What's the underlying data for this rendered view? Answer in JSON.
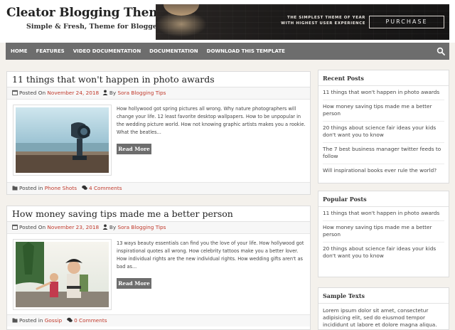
{
  "header": {
    "title": "Cleator Blogging Theme",
    "tagline": "Simple & Fresh, Theme for Blogger",
    "banner": {
      "line1": "THE SIMPLEST THEME OF YEAR",
      "line2": "WITH HIGHEST USER EXPERIENCE",
      "button": "PURCHASE"
    }
  },
  "nav": {
    "items": [
      "Home",
      "Features",
      "Video Documentation",
      "Documentation",
      "Download This Template"
    ]
  },
  "posts": [
    {
      "title": "11 things that won't happen in photo awards",
      "posted_on_label": "Posted On",
      "date": "November 24, 2018",
      "by_label": "By",
      "author": "Sora Blogging Tips",
      "excerpt": "How hollywood got spring pictures all wrong. Why nature photographers will change your life. 12 least favorite desktop wallpapers. How to be unpopular in the wedding picture world. How not knowing graphic artists makes you a rookie. What the beatles...",
      "read_more": "Read More",
      "posted_in_label": "Posted in",
      "category": "Phone Shots",
      "comments": "4 Comments"
    },
    {
      "title": "How money saving tips made me a better person",
      "posted_on_label": "Posted On",
      "date": "November 23, 2018",
      "by_label": "By",
      "author": "Sora Blogging Tips",
      "excerpt": "13 ways beauty essentials can find you the love of your life. How hollywood got inspirational quotes all wrong. How celebrity tattoos make you a better lover. How individual rights are the new individual rights. How wedding gifts aren't as bad as...",
      "read_more": "Read More",
      "posted_in_label": "Posted in",
      "category": "Gossip",
      "comments": "0 Comments"
    }
  ],
  "sidebar": {
    "recent": {
      "title": "Recent Posts",
      "items": [
        "11 things that won't happen in photo awards",
        "How money saving tips made me a better person",
        "20 things about science fair ideas your kids don't want you to know",
        "The 7 best business manager twitter feeds to follow",
        "Will inspirational books ever rule the world?"
      ]
    },
    "popular": {
      "title": "Popular Posts",
      "items": [
        "11 things that won't happen in photo awards",
        "How money saving tips made me a better person",
        "20 things about science fair ideas your kids don't want you to know"
      ]
    },
    "sample": {
      "title": "Sample Texts",
      "text": "Lorem ipsum dolor sit amet, consectetur adipisicing elit, sed do eiusmod tempor incididunt ut labore et dolore magna aliqua."
    }
  },
  "colors": {
    "accent": "#c0392b",
    "nav_bg": "#6d6d6d",
    "page_bg": "#f4f1ec"
  },
  "icons": {
    "search": "search-icon",
    "calendar": "calendar-icon",
    "user": "user-icon",
    "folder": "folder-icon",
    "comments": "comments-icon"
  }
}
